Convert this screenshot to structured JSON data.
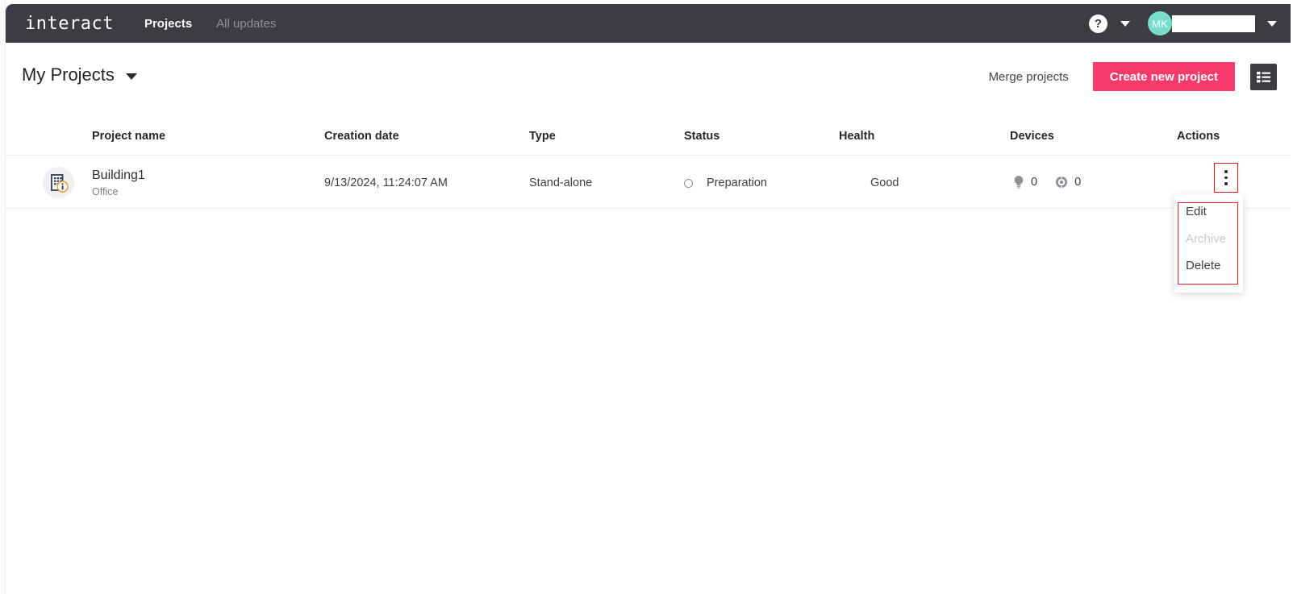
{
  "topbar": {
    "brand": "interact",
    "nav": [
      {
        "label": "Projects",
        "active": true
      },
      {
        "label": "All updates",
        "active": false
      }
    ],
    "help_icon_glyph": "?",
    "help_icon_name": "help-circle-icon",
    "help_caret_name": "chevron-down-icon",
    "avatar_initials": "MK",
    "user_name_value": "",
    "user_caret_name": "chevron-down-icon",
    "bar_color": "#3b3d42",
    "avatar_color": "#79ddcd"
  },
  "page_header": {
    "title": "My Projects",
    "title_caret_name": "chevron-down-icon",
    "merge_label": "Merge projects",
    "create_label": "Create new project",
    "create_color": "#f8396b",
    "view_toggle_name": "list-view-icon"
  },
  "table": {
    "columns": [
      "Project name",
      "Creation date",
      "Type",
      "Status",
      "Health",
      "Devices",
      "Actions"
    ],
    "rows": [
      {
        "icon_name": "building-info-icon",
        "name": "Building1",
        "subtitle": "Office",
        "creation_date": "9/13/2024, 11:24:07 AM",
        "type": "Stand-alone",
        "status": "Preparation",
        "status_icon_name": "status-circle-icon",
        "health": "Good",
        "devices": [
          {
            "icon_name": "lightbulb-icon",
            "count": "0"
          },
          {
            "icon_name": "sensor-icon",
            "count": "0"
          }
        ],
        "actions_icon_name": "kebab-menu-icon"
      }
    ]
  },
  "context_menu": {
    "open": true,
    "items": [
      {
        "label": "Edit",
        "disabled": false
      },
      {
        "label": "Archive",
        "disabled": true
      },
      {
        "label": "Delete",
        "disabled": false
      }
    ],
    "highlight_color": "#e01b24"
  }
}
